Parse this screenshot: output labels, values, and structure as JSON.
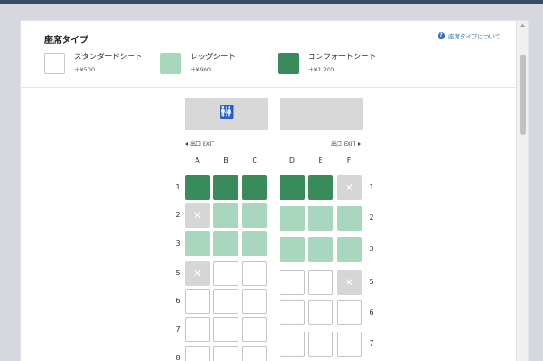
{
  "legend": {
    "title": "座席タイプ",
    "help": "座席タイプについて",
    "items": [
      {
        "name": "スタンダードシート",
        "price": "＋¥500",
        "type": "standard"
      },
      {
        "name": "レッグシート",
        "price": "＋¥900",
        "type": "leg"
      },
      {
        "name": "コンフォートシート",
        "price": "＋¥1,200",
        "type": "comfort"
      }
    ]
  },
  "exits": {
    "left": "出口 EXIT",
    "right": "出口 EXIT"
  },
  "icons": {
    "help": "help-circle-icon",
    "toilet": "restroom-icon",
    "close": "close-icon"
  },
  "colors": {
    "comfort": "#3a8b5c",
    "leg": "#a8d7bd",
    "standard": "#ffffff",
    "unavailable": "#d6d6d6",
    "link": "#2a6bbf"
  },
  "columns": [
    "A",
    "B",
    "C",
    "D",
    "E",
    "F"
  ],
  "rows": [
    {
      "left_label": "1",
      "right_label": "1",
      "seats": [
        "comfort",
        "comfort",
        "comfort",
        "comfort",
        "comfort",
        "unavailable"
      ]
    },
    {
      "left_label": "2",
      "right_label": "2",
      "seats": [
        "unavailable",
        "leg",
        "leg",
        "leg",
        "leg",
        "leg"
      ]
    },
    {
      "left_label": "3",
      "right_label": "3",
      "seats": [
        "leg",
        "leg",
        "leg",
        "leg",
        "leg",
        "leg"
      ]
    },
    {
      "left_label": "5",
      "right_label": "5",
      "seats": [
        "unavailable",
        "standard",
        "standard",
        "standard",
        "standard",
        "unavailable"
      ]
    },
    {
      "left_label": "6",
      "right_label": "6",
      "seats": [
        "standard",
        "standard",
        "standard",
        "standard",
        "standard",
        "standard"
      ]
    },
    {
      "left_label": "7",
      "right_label": "7",
      "seats": [
        "standard",
        "standard",
        "standard",
        "standard",
        "standard",
        "standard"
      ]
    },
    {
      "left_label": "8",
      "right_label": "",
      "seats": [
        "standard",
        "standard",
        "standard",
        "",
        "",
        ""
      ]
    }
  ]
}
